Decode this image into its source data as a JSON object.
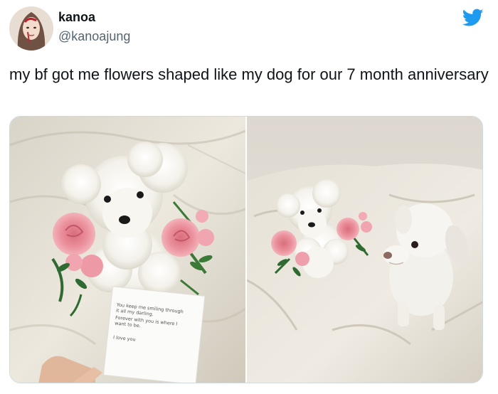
{
  "tweet": {
    "author": {
      "display_name": "kanoa",
      "handle": "@kanoajung",
      "avatar_icon": "profile-photo"
    },
    "platform_icon": "twitter-bird-icon",
    "text": "my bf got me flowers shaped like my dog for our 7 month anniversary",
    "colors": {
      "brand": "#1d9bf0",
      "text": "#0f1419",
      "secondary": "#536471"
    },
    "media": {
      "note_lines": [
        "You keep me smiling through",
        "it all my darling.",
        "Forever with you is where I",
        "want to be.",
        "I love you"
      ]
    }
  }
}
